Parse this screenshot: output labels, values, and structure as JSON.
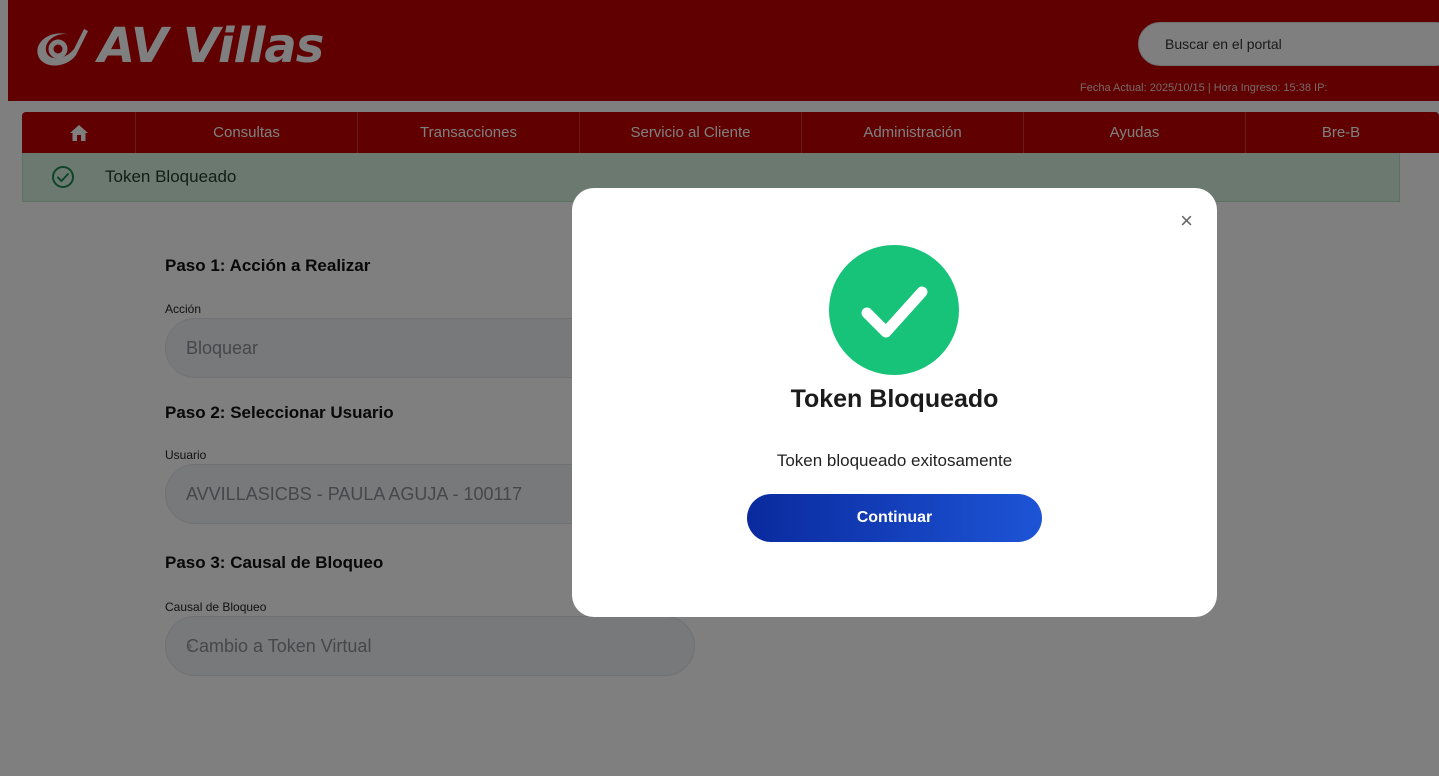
{
  "header": {
    "brand": "AV Villas",
    "search_placeholder": "Buscar en el portal",
    "session_info": "Fecha Actual: 2025/10/15 | Hora Ingreso: 15:38    IP:"
  },
  "nav": {
    "items": [
      {
        "label": "Consultas"
      },
      {
        "label": "Transacciones"
      },
      {
        "label": "Servicio al Cliente"
      },
      {
        "label": "Administración"
      },
      {
        "label": "Ayudas"
      },
      {
        "label": "Bre-B"
      }
    ]
  },
  "alert": {
    "text": "Token Bloqueado"
  },
  "form": {
    "step1": {
      "title": "Paso 1: Acción a Realizar",
      "label": "Acción",
      "value": "Bloquear"
    },
    "step2": {
      "title": "Paso 2: Seleccionar Usuario",
      "label": "Usuario",
      "value": "AVVILLASICBS - PAULA AGUJA - 100117"
    },
    "step3": {
      "title": "Paso 3: Causal de Bloqueo",
      "label": "Causal de Bloqueo",
      "value": "Cambio a Token Virtual"
    }
  },
  "overlay": {
    "counter": "0"
  },
  "modal": {
    "close": "×",
    "title": "Token Bloqueado",
    "message": "Token bloqueado exitosamente",
    "button": "Continuar"
  },
  "colors": {
    "brand_red": "#c00000",
    "success_green": "#16c378",
    "button_blue": "#0a2a9e"
  }
}
